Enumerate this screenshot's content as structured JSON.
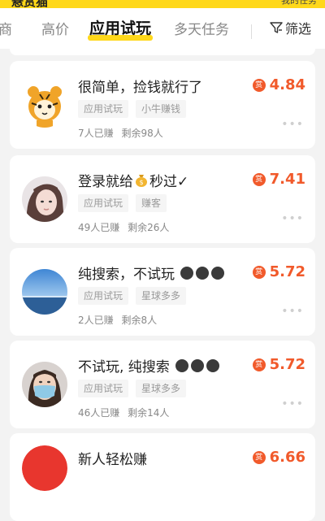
{
  "header": {
    "top_title": "悬赏猫",
    "top_right": "我的任务"
  },
  "tabs": [
    {
      "label": "商"
    },
    {
      "label": "高价"
    },
    {
      "label": "应用试玩"
    },
    {
      "label": "多天任务"
    }
  ],
  "filter_label": "筛选",
  "tasks": [
    {
      "title": "很简单，捡钱就行了",
      "tags": [
        "应用试玩",
        "小牛赚钱"
      ],
      "earned": "7人已赚",
      "remaining": "剩余98人",
      "reward": "4.84",
      "avatar": "tiger-cartoon-avatar"
    },
    {
      "title": "登录就给",
      "title_suffix": "秒过✓",
      "title_icon": "money-bag-icon",
      "tags": [
        "应用试玩",
        "赚客"
      ],
      "earned": "49人已赚",
      "remaining": "剩余26人",
      "reward": "7.41",
      "avatar": "girl-photo-avatar"
    },
    {
      "title": "纯搜索，不试玩",
      "tags": [
        "应用试玩",
        "星球多多"
      ],
      "earned": "2人已赚",
      "remaining": "剩余8人",
      "reward": "5.72",
      "avatar": "sea-sky-avatar"
    },
    {
      "title": "不试玩, 纯搜索",
      "tags": [
        "应用试玩",
        "星球多多"
      ],
      "earned": "46人已赚",
      "remaining": "剩余14人",
      "reward": "5.72",
      "avatar": "masked-girl-avatar"
    },
    {
      "title": "新人轻松赚",
      "reward": "6.66",
      "avatar": "red-badge-avatar"
    }
  ],
  "reward_badge": "赏",
  "colors": {
    "accent": "#ffd81a",
    "reward": "#f15a2b"
  }
}
